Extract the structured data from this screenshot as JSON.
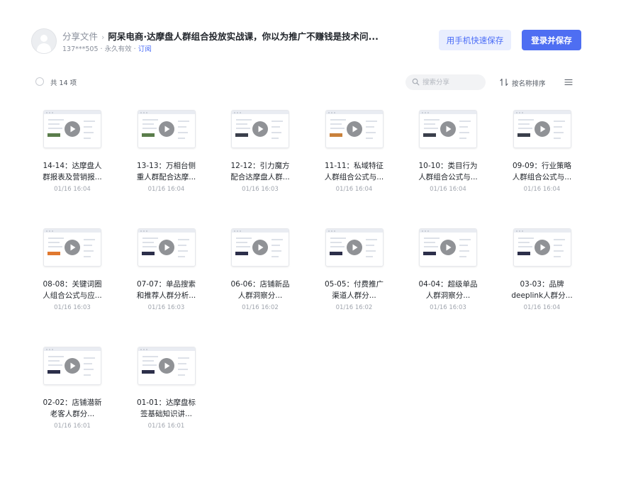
{
  "header": {
    "breadcrumb": "分享文件",
    "title": "阿呆电商·达摩盘人群组合投放实战课，你以为推广不赚钱是技术问...",
    "user_id": "137***505",
    "validity": "永久有效",
    "subscribe_label": "订阅",
    "mobile_save_label": "用手机快速保存",
    "login_save_label": "登录并保存"
  },
  "toolbar": {
    "count_label": "共 14 项",
    "search_placeholder": "搜索分享",
    "sort_label": "按名称排序",
    "icons": {
      "search": "search-icon",
      "sort": "sort-icon",
      "menu": "menu-icon"
    }
  },
  "files": [
    {
      "name_line1": "14-14：达摩盘人",
      "name_line2": "群报表及营销报...",
      "time": "01/16 16:04",
      "accent": "#5a7d4b"
    },
    {
      "name_line1": "13-13：万相台侧",
      "name_line2": "重人群配合达摩...",
      "time": "01/16 16:04",
      "accent": "#5a7d4b"
    },
    {
      "name_line1": "12-12：引力魔方",
      "name_line2": "配合达摩盘人群...",
      "time": "01/16 16:03",
      "accent": "#3a3f4b"
    },
    {
      "name_line1": "11-11：私域特征",
      "name_line2": "人群组合公式与...",
      "time": "01/16 16:04",
      "accent": "#c9813b"
    },
    {
      "name_line1": "10-10：类目行为",
      "name_line2": "人群组合公式与...",
      "time": "01/16 16:04",
      "accent": "#3a3f4b"
    },
    {
      "name_line1": "09-09：行业策略",
      "name_line2": "人群组合公式与...",
      "time": "01/16 16:04",
      "accent": "#3a3f4b"
    },
    {
      "name_line1": "08-08：关键词圈",
      "name_line2": "人组合公式与应...",
      "time": "01/16 16:03",
      "accent": "#e0782f"
    },
    {
      "name_line1": "07-07：单品搜索",
      "name_line2": "和推荐人群分析...",
      "time": "01/16 16:03",
      "accent": "#2c2f4a"
    },
    {
      "name_line1": "06-06：店铺新品",
      "name_line2": "人群洞察分...",
      "time": "01/16 16:02",
      "accent": "#2c2f4a"
    },
    {
      "name_line1": "05-05：付费推广",
      "name_line2": "渠道人群分...",
      "time": "01/16 16:02",
      "accent": "#2c2f4a"
    },
    {
      "name_line1": "04-04：超级单品",
      "name_line2": "人群洞察分...",
      "time": "01/16 16:03",
      "accent": "#2c2f4a"
    },
    {
      "name_line1": "03-03：品牌",
      "name_line2": "deeplink人群分...",
      "time": "01/16 16:04",
      "accent": "#2c2f4a"
    },
    {
      "name_line1": "02-02：店铺潜新",
      "name_line2": "老客人群分...",
      "time": "01/16 16:01",
      "accent": "#2c2f4a"
    },
    {
      "name_line1": "01-01：达摩盘标",
      "name_line2": "签基础知识讲...",
      "time": "01/16 16:01",
      "accent": "#2c2f4a"
    }
  ],
  "colors": {
    "primary": "#4e6ef2",
    "secondary_bg": "#e9eefe",
    "link": "#4a6cf7",
    "play": "#7d7f84"
  }
}
